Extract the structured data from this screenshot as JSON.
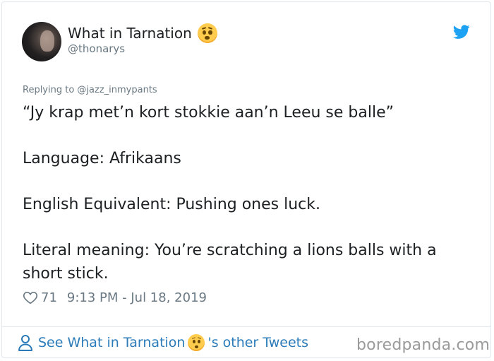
{
  "tweet": {
    "author": {
      "display_name": "What in Tarnation",
      "name_emoji": "worried-face-emoji",
      "handle": "@thonarys"
    },
    "reply_to": "Replying to @jazz_inmypants",
    "text_lines": [
      "“Jy krap met’n kort stokkie aan’n Leeu se balle”",
      "Language: Afrikaans",
      "English Equivalent: Pushing ones luck.",
      "Literal meaning: You’re scratching a lions balls with a short stick."
    ],
    "likes": "71",
    "timestamp": "9:13 PM - Jul 18, 2019",
    "brand_icon": "twitter-bird-icon",
    "brand_color": "#1da1f2"
  },
  "footer": {
    "link_prefix": "See What in Tarnation",
    "link_suffix": "'s other Tweets",
    "link_color": "#2b7bb9"
  },
  "watermark": "boredpanda.com"
}
